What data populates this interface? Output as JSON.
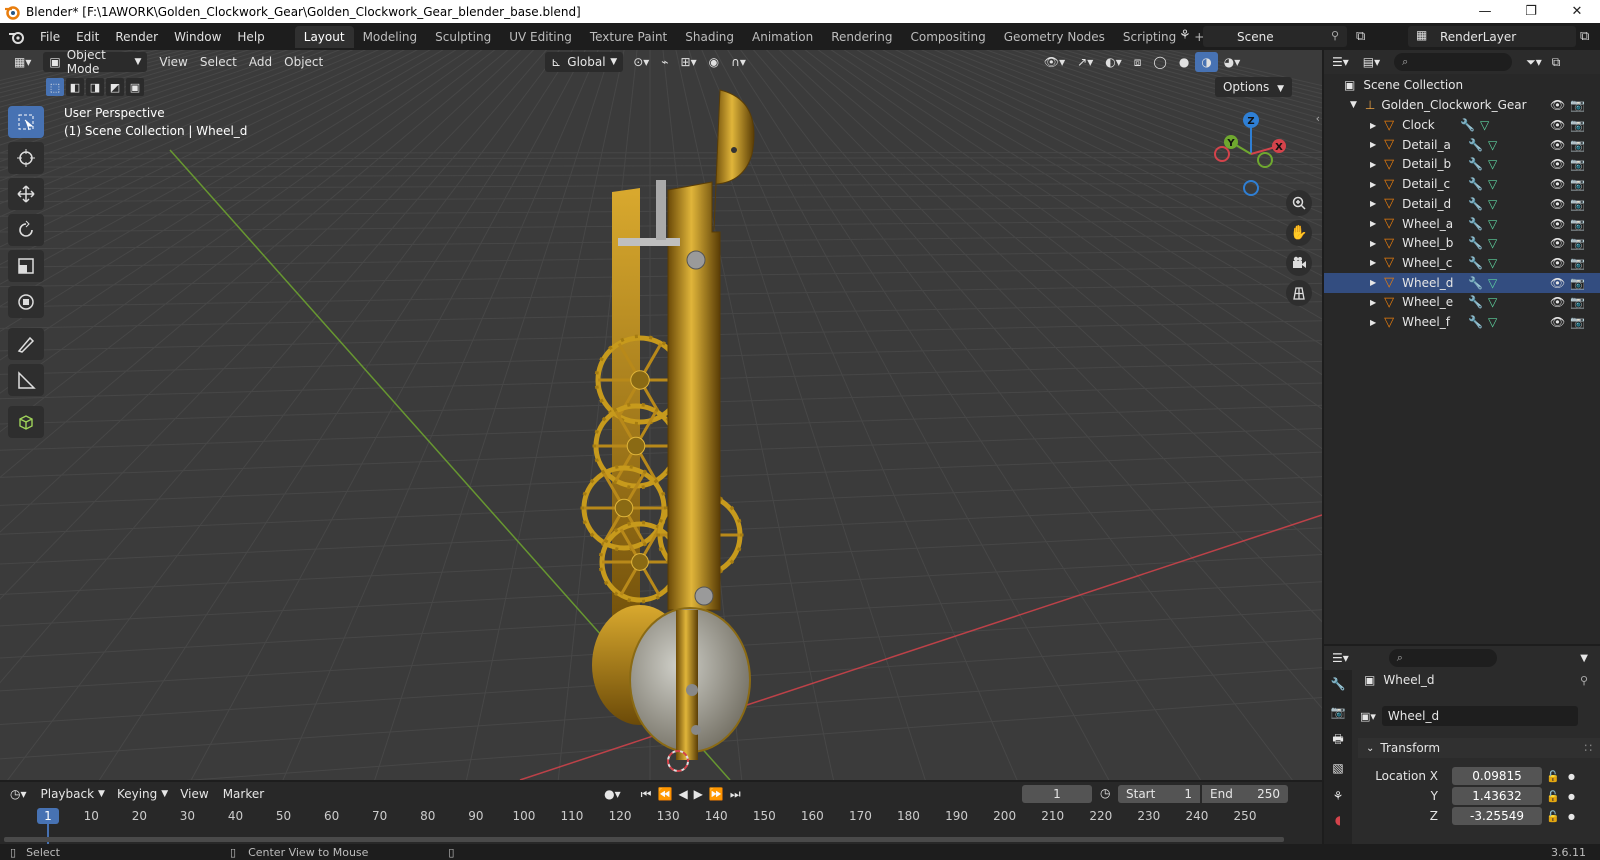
{
  "window": {
    "title": "Blender* [F:\\1AWORK\\Golden_Clockwork_Gear\\Golden_Clockwork_Gear_blender_base.blend]"
  },
  "menu": [
    "File",
    "Edit",
    "Render",
    "Window",
    "Help"
  ],
  "workspaces": [
    "Layout",
    "Modeling",
    "Sculpting",
    "UV Editing",
    "Texture Paint",
    "Shading",
    "Animation",
    "Rendering",
    "Compositing",
    "Geometry Nodes",
    "Scripting"
  ],
  "active_workspace": "Layout",
  "scene": "Scene",
  "render_layer": "RenderLayer",
  "viewport": {
    "mode": "Object Mode",
    "menus": [
      "View",
      "Select",
      "Add",
      "Object"
    ],
    "transform_orientation": "Global",
    "options": "Options",
    "perspective_label": "User Perspective",
    "collection_label": "(1) Scene Collection | Wheel_d",
    "gizmo": {
      "x": "X",
      "y": "Y",
      "z": "Z"
    }
  },
  "outliner": {
    "root": "Scene Collection",
    "collection": "Golden_Clockwork_Gear",
    "objects": [
      "Clock",
      "Detail_a",
      "Detail_b",
      "Detail_c",
      "Detail_d",
      "Wheel_a",
      "Wheel_b",
      "Wheel_c",
      "Wheel_d",
      "Wheel_e",
      "Wheel_f"
    ],
    "selected": "Wheel_d"
  },
  "properties": {
    "object_name": "Wheel_d",
    "data_name": "Wheel_d",
    "panel": "Transform",
    "location": {
      "label": "Location X",
      "x": "0.09815",
      "y_label": "Y",
      "y": "1.43632",
      "z_label": "Z",
      "z": "-3.25549"
    }
  },
  "timeline": {
    "menus": [
      "Playback",
      "Keying",
      "View",
      "Marker"
    ],
    "current_frame": "1",
    "start_label": "Start",
    "start": "1",
    "end_label": "End",
    "end": "250",
    "ruler": [
      "1",
      "10",
      "20",
      "30",
      "40",
      "50",
      "60",
      "70",
      "80",
      "90",
      "100",
      "110",
      "120",
      "130",
      "140",
      "150",
      "160",
      "170",
      "180",
      "190",
      "200",
      "210",
      "220",
      "230",
      "240",
      "250"
    ]
  },
  "status": {
    "left": "Select",
    "middle": "Center View to Mouse",
    "version": "3.6.11"
  },
  "colors": {
    "accent": "#4772b3",
    "selection": "#334d80",
    "x_axis": "#d4434b",
    "y_axis": "#6fa82f",
    "z_axis": "#2f7fd4",
    "gold": "#c79a1c"
  }
}
